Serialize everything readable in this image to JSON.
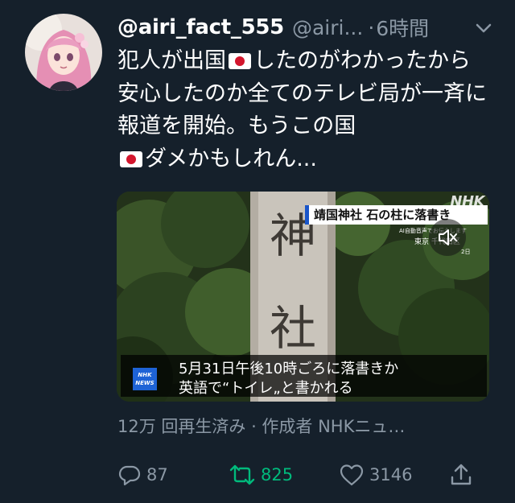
{
  "tweet": {
    "display_name": "@airi_fact_555",
    "handle": "@airi...",
    "separator": "·",
    "time": "6時間",
    "text_parts": [
      "犯人が出国",
      "したのがわかったから安心したのか全てのテレビ局が一斉に報道を開始。もうこの国",
      "ダメかもしれん..."
    ]
  },
  "media": {
    "caption_top": "靖国神社 石の柱に落書き",
    "logo_top": "NHK",
    "ai_note": "AI自動音声でお伝えします",
    "location": "東京 千代田区",
    "location_date": "2日",
    "lower_third_line1": "5月31日午後10時ごろに落書きか",
    "lower_third_line2": "英語で“トイレ„と書かれる",
    "badge_line1": "NHK",
    "badge_line2": "NEWS",
    "pillar_chars": [
      "神",
      "社"
    ]
  },
  "views_text": "12万 回再生済み · 作成者 NHKニュ…",
  "actions": {
    "reply_count": "87",
    "retweet_count": "825",
    "like_count": "3146"
  },
  "colors": {
    "background": "#15202b",
    "secondary_text": "#8b98a5",
    "retweet_green": "#00ba7c"
  },
  "icons": [
    "chevron-down-icon",
    "reply-icon",
    "retweet-icon",
    "like-icon",
    "share-icon",
    "mute-icon",
    "japan-flag-icon"
  ]
}
